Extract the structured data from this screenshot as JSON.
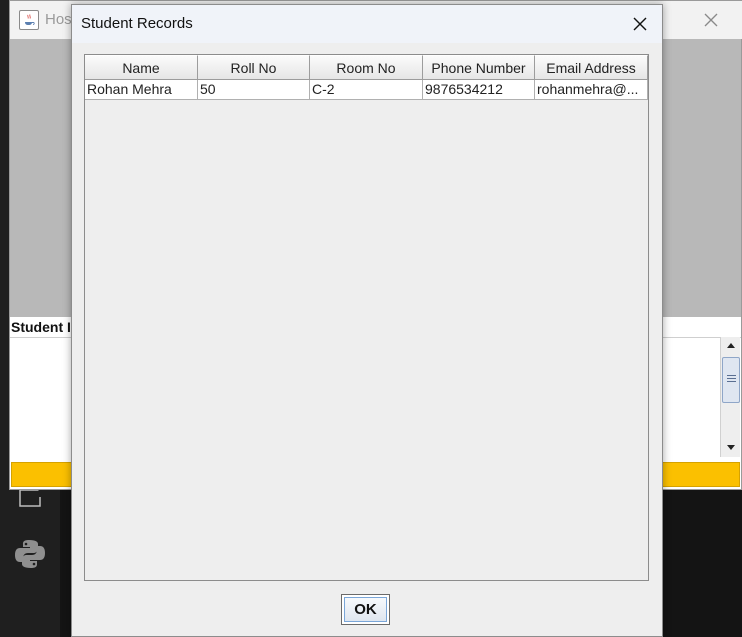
{
  "parent_window": {
    "title": "Hos",
    "section_label": "Student I",
    "accent_color": "#fbc000"
  },
  "dialog": {
    "title": "Student Records",
    "ok_label": "OK"
  },
  "table": {
    "columns": [
      "Name",
      "Roll No",
      "Room No",
      "Phone Number",
      "Email Address"
    ],
    "rows": [
      [
        "Rohan Mehra",
        "50",
        "C-2",
        "9876534212",
        "rohanmehra@..."
      ]
    ]
  },
  "icons": {
    "parent_app": "java-icon",
    "parent_close": "close-icon",
    "dialog_close": "close-icon",
    "scroll_up": "arrow-up-icon",
    "scroll_down": "arrow-down-icon",
    "taskbar_file": "file-icon",
    "taskbar_python": "python-icon"
  }
}
